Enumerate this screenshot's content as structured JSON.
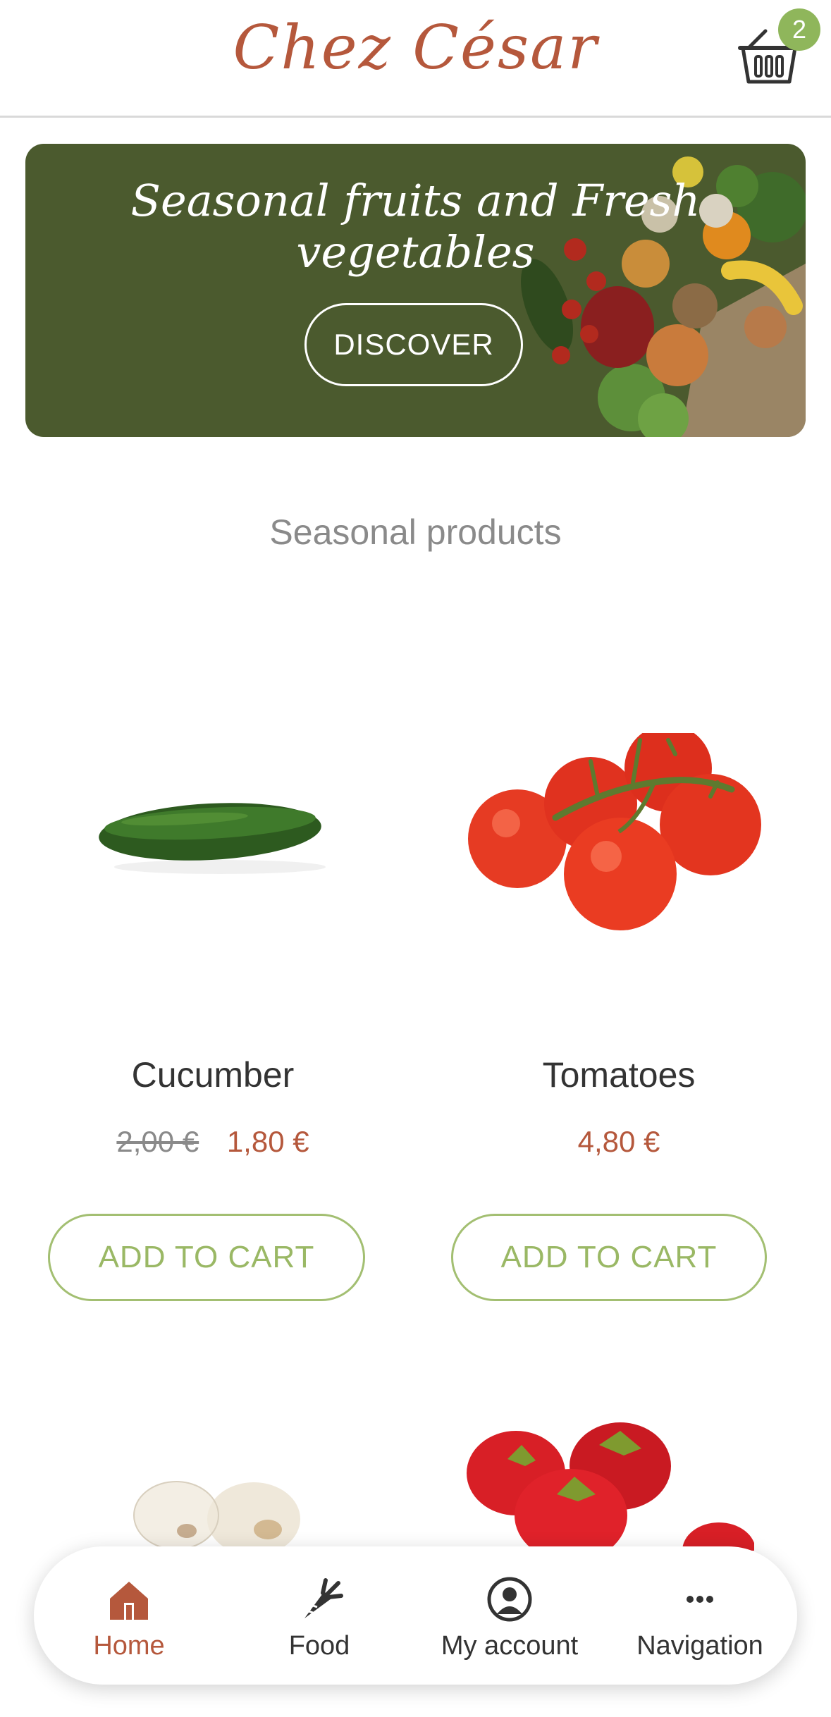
{
  "header": {
    "logo": "Chez César",
    "cart_count": "2"
  },
  "banner": {
    "title": "Seasonal fruits and Fresh vegetables",
    "button_label": "DISCOVER"
  },
  "section": {
    "title": "Seasonal products"
  },
  "products": [
    {
      "name": "Cucumber",
      "old_price": "2,00 €",
      "price": "1,80 €",
      "button_label": "ADD TO CART"
    },
    {
      "name": "Tomatoes",
      "price": "4,80 €",
      "button_label": "ADD TO CART"
    }
  ],
  "bottom_nav": [
    {
      "label": "Home",
      "icon": "home-icon",
      "active": true
    },
    {
      "label": "Food",
      "icon": "carrot-icon",
      "active": false
    },
    {
      "label": "My account",
      "icon": "user-icon",
      "active": false
    },
    {
      "label": "Navigation",
      "icon": "more-icon",
      "active": false
    }
  ],
  "colors": {
    "brand": "#b5583c",
    "accent_green": "#8fb65b",
    "banner_bg": "#4b5a2e",
    "muted_text": "#8a8a8a"
  }
}
